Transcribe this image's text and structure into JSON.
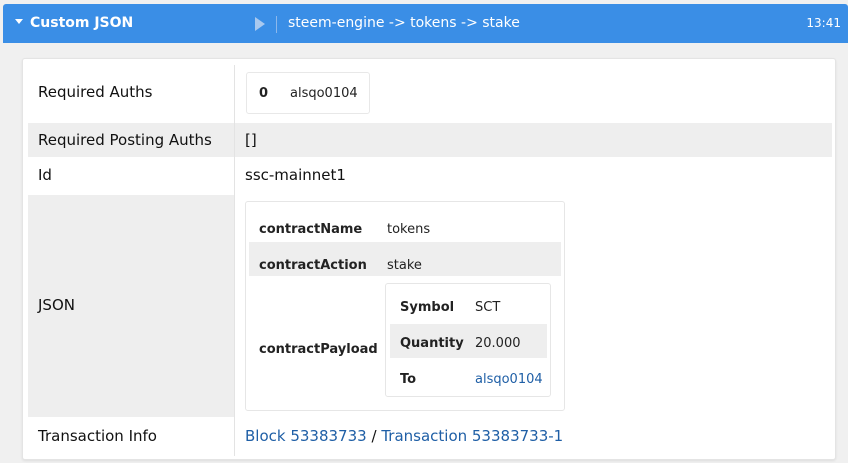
{
  "header": {
    "title": "Custom JSON",
    "path": "steem-engine -> tokens -> stake",
    "time": "13:41"
  },
  "rows": {
    "required_auths_label": "Required Auths",
    "required_auths": {
      "index": "0",
      "account": "alsqo0104"
    },
    "required_posting_auths_label": "Required Posting Auths",
    "required_posting_auths_value": "[]",
    "id_label": "Id",
    "id_value": "ssc-mainnet1",
    "json_label": "JSON",
    "transaction_info_label": "Transaction Info"
  },
  "json": {
    "contractName_key": "contractName",
    "contractName_value": "tokens",
    "contractAction_key": "contractAction",
    "contractAction_value": "stake",
    "contractPayload_key": "contractPayload",
    "payload": {
      "symbol_key": "Symbol",
      "symbol_value": "SCT",
      "quantity_key": "Quantity",
      "quantity_value": "20.000",
      "to_key": "To",
      "to_value": "alsqo0104"
    }
  },
  "transaction": {
    "block_link": "Block 53383733",
    "separator": "/",
    "transaction_link": "Transaction 53383733-1"
  },
  "colors": {
    "header_bg": "#3a8ee6",
    "link": "#1f5fa6"
  }
}
